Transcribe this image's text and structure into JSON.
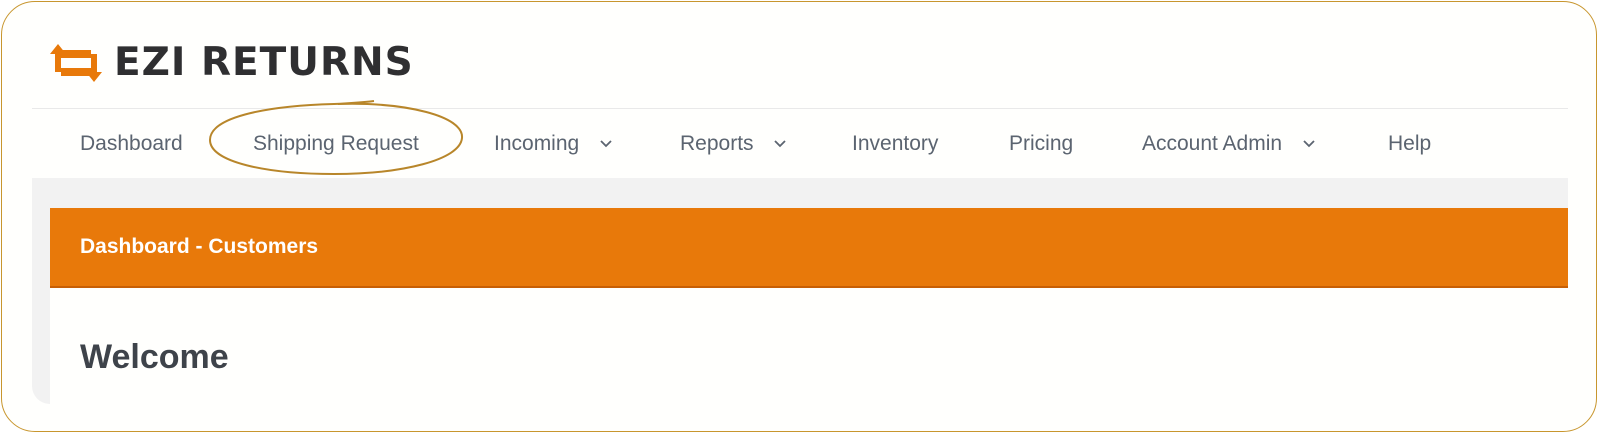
{
  "brand": {
    "name": "EZI RETURNS",
    "logo_icon": "swap-arrows-icon",
    "accent_color": "#e8790a",
    "text_color": "#2f2f31"
  },
  "nav": {
    "items": [
      {
        "label": "Dashboard",
        "dropdown": false
      },
      {
        "label": "Shipping Request",
        "dropdown": false,
        "highlighted": true
      },
      {
        "label": "Incoming",
        "dropdown": true
      },
      {
        "label": "Reports",
        "dropdown": true
      },
      {
        "label": "Inventory",
        "dropdown": false
      },
      {
        "label": "Pricing",
        "dropdown": false
      },
      {
        "label": "Account Admin",
        "dropdown": true
      },
      {
        "label": "Help",
        "dropdown": false
      }
    ],
    "highlight_color": "#b8862a"
  },
  "panel": {
    "header": "Dashboard - Customers",
    "title": "Welcome"
  }
}
